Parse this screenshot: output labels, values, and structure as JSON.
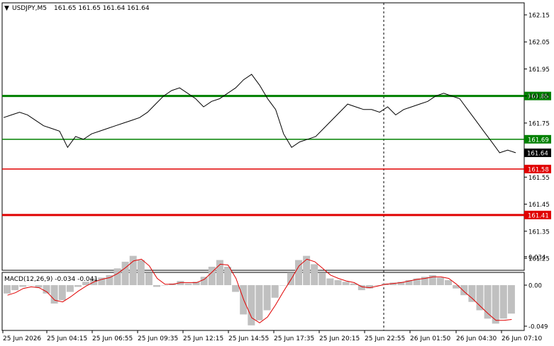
{
  "header": {
    "symbol": "USDJPY,M5",
    "ohlc": "161.65 161.65 161.64 161.64",
    "menu_arrow": "triangle-down-icon"
  },
  "price_axis": {
    "ticks": [
      "162.15",
      "162.05",
      "161.95",
      "161.85",
      "161.75",
      "161.64",
      "161.55",
      "161.45",
      "161.35",
      "161.25"
    ],
    "ylim": [
      161.2,
      162.2
    ]
  },
  "levels": [
    {
      "label": "161.85",
      "price": 161.85,
      "color": "#008000",
      "width": "thick"
    },
    {
      "label": "161.69",
      "price": 161.69,
      "color": "#008000",
      "width": "thin"
    },
    {
      "label": "161.58",
      "price": 161.58,
      "color": "#e00000",
      "width": "thin"
    },
    {
      "label": "161.41",
      "price": 161.41,
      "color": "#e00000",
      "width": "thick"
    }
  ],
  "current_price": {
    "label": "161.64",
    "price": 161.64
  },
  "time_axis": {
    "labels": [
      "25 Jun 2026",
      "25 Jun 04:15",
      "25 Jun 06:55",
      "25 Jun 09:35",
      "25 Jun 12:15",
      "25 Jun 14:55",
      "25 Jun 17:35",
      "25 Jun 20:15",
      "25 Jun 22:55",
      "26 Jun 01:50",
      "26 Jun 04:30",
      "26 Jun 07:10"
    ]
  },
  "macd": {
    "title": "MACD(12,26,9) -0.034 -0.041",
    "ticks": [
      "0.034",
      "0.00",
      "-0.049"
    ],
    "ylim": [
      -0.055,
      0.04
    ]
  },
  "chart_data": [
    {
      "type": "line",
      "title": "USDJPY,M5",
      "series": [
        {
          "name": "USDJPY",
          "values": [
            161.77,
            161.78,
            161.79,
            161.78,
            161.76,
            161.74,
            161.73,
            161.72,
            161.66,
            161.7,
            161.69,
            161.71,
            161.72,
            161.73,
            161.74,
            161.75,
            161.76,
            161.77,
            161.79,
            161.82,
            161.85,
            161.87,
            161.88,
            161.86,
            161.84,
            161.81,
            161.83,
            161.84,
            161.86,
            161.88,
            161.91,
            161.93,
            161.89,
            161.84,
            161.8,
            161.71,
            161.66,
            161.68,
            161.69,
            161.7,
            161.73,
            161.76,
            161.79,
            161.82,
            161.81,
            161.8,
            161.8,
            161.79,
            161.81,
            161.78,
            161.8,
            161.81,
            161.82,
            161.83,
            161.85,
            161.86,
            161.85,
            161.84,
            161.8,
            161.76,
            161.72,
            161.68,
            161.64,
            161.65,
            161.64
          ]
        }
      ],
      "ylim": [
        161.2,
        162.2
      ]
    },
    {
      "type": "bar",
      "title": "MACD(12,26,9)",
      "series": [
        {
          "name": "MACD",
          "values": [
            -0.01,
            -0.006,
            -0.002,
            0.0,
            -0.003,
            -0.01,
            -0.022,
            -0.018,
            -0.008,
            -0.002,
            0.004,
            0.008,
            0.009,
            0.012,
            0.02,
            0.028,
            0.035,
            0.03,
            0.015,
            -0.002,
            0.0,
            0.002,
            0.005,
            0.002,
            0.004,
            0.01,
            0.022,
            0.03,
            0.022,
            -0.008,
            -0.035,
            -0.048,
            -0.042,
            -0.03,
            -0.015,
            0.0,
            0.015,
            0.03,
            0.035,
            0.025,
            0.015,
            0.008,
            0.006,
            0.004,
            0.002,
            -0.006,
            -0.004,
            0.0,
            0.002,
            0.003,
            0.004,
            0.006,
            0.008,
            0.01,
            0.012,
            0.009,
            0.006,
            -0.004,
            -0.012,
            -0.02,
            -0.03,
            -0.04,
            -0.046,
            -0.04,
            -0.034
          ]
        },
        {
          "name": "Signal",
          "values": [
            -0.012,
            -0.009,
            -0.004,
            -0.002,
            -0.003,
            -0.008,
            -0.018,
            -0.02,
            -0.014,
            -0.007,
            -0.001,
            0.004,
            0.007,
            0.009,
            0.014,
            0.021,
            0.029,
            0.031,
            0.023,
            0.008,
            0.001,
            0.001,
            0.003,
            0.003,
            0.003,
            0.007,
            0.016,
            0.025,
            0.024,
            0.008,
            -0.018,
            -0.039,
            -0.045,
            -0.038,
            -0.024,
            -0.008,
            0.007,
            0.023,
            0.031,
            0.028,
            0.02,
            0.012,
            0.008,
            0.005,
            0.003,
            -0.002,
            -0.003,
            -0.001,
            0.001,
            0.002,
            0.003,
            0.005,
            0.007,
            0.008,
            0.01,
            0.01,
            0.008,
            0.001,
            -0.008,
            -0.016,
            -0.025,
            -0.034,
            -0.042,
            -0.042,
            -0.041
          ]
        }
      ],
      "ylim": [
        -0.055,
        0.04
      ]
    }
  ]
}
